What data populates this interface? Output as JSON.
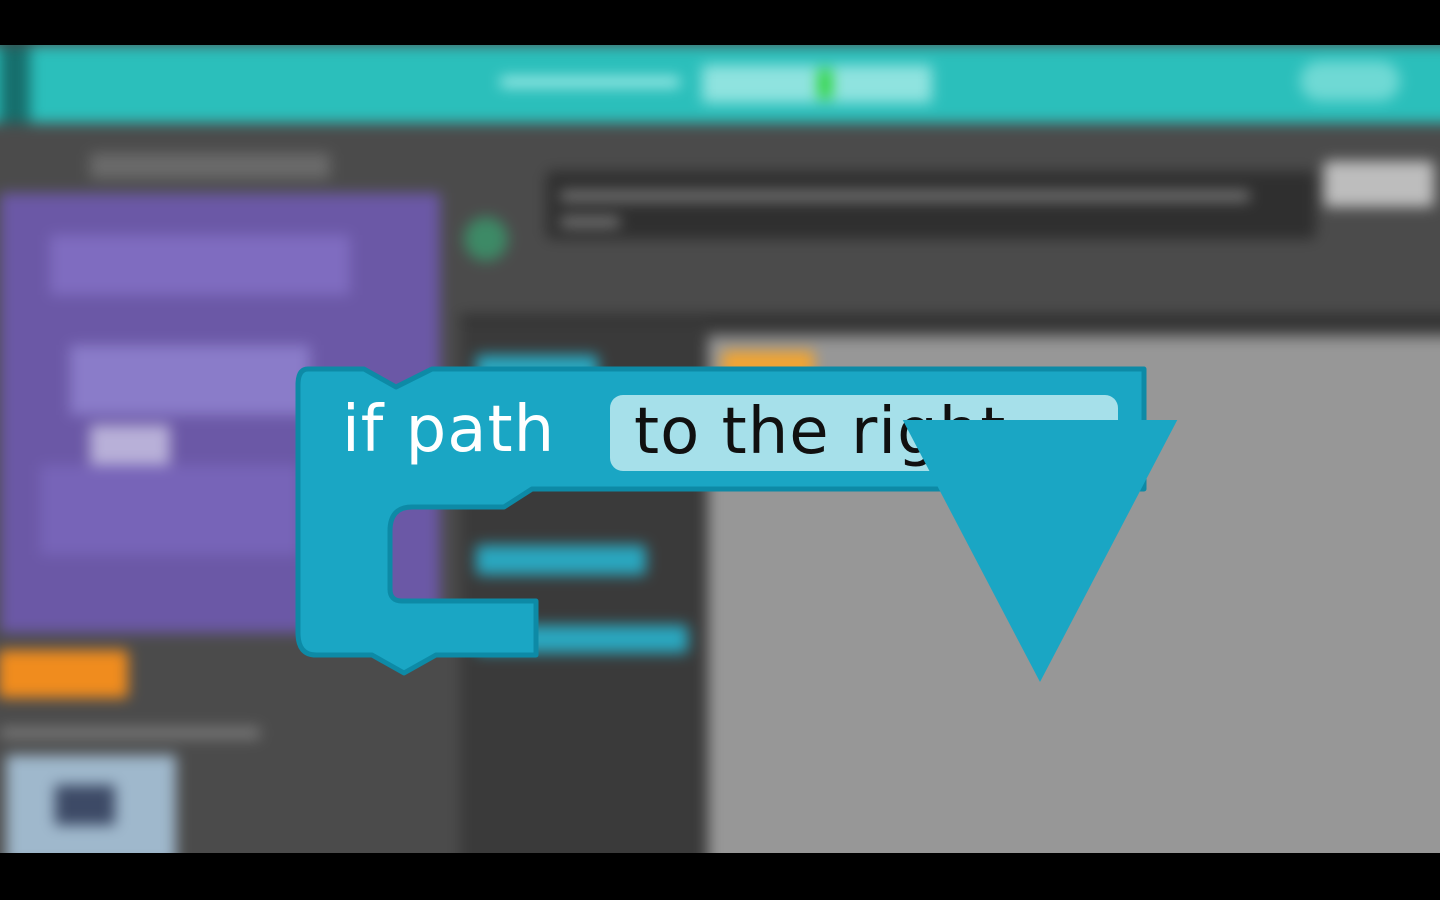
{
  "block": {
    "keyword": "if path",
    "selected_option": "to the right",
    "dropdown_icon": "triangle-down-icon"
  },
  "colors": {
    "block_fill": "#1aa6c4",
    "block_edge": "#0d8aa6",
    "dropdown_fill": "#a6e0ea",
    "background_header": "#2bbfbb",
    "background_workspace": "#979797"
  }
}
